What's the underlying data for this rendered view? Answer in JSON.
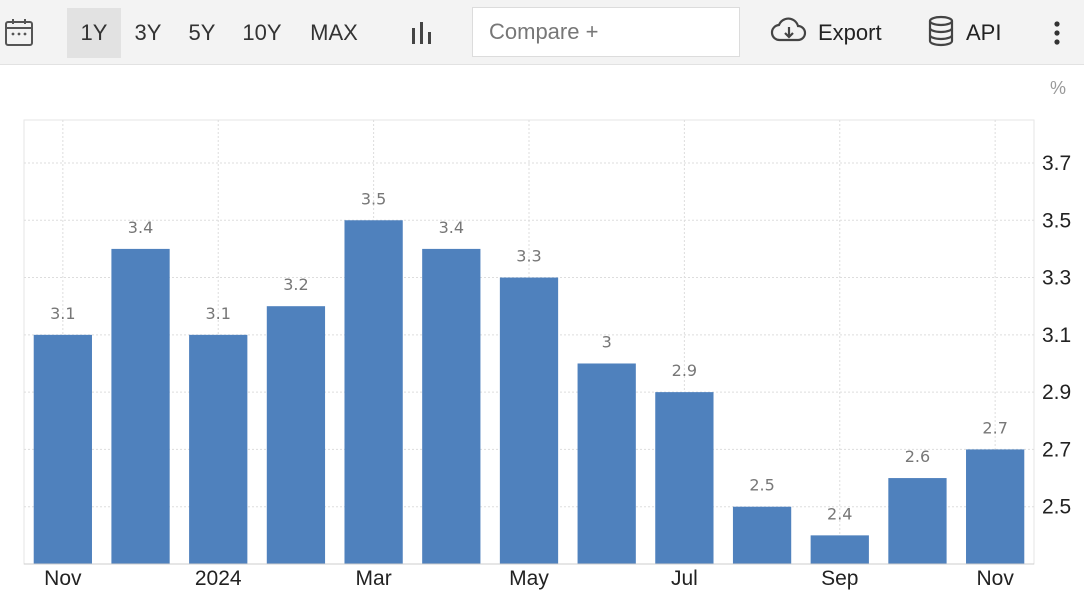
{
  "toolbar": {
    "calendar_icon": "calendar-icon",
    "ranges": [
      {
        "label": "1Y",
        "active": true
      },
      {
        "label": "3Y",
        "active": false
      },
      {
        "label": "5Y",
        "active": false
      },
      {
        "label": "10Y",
        "active": false
      },
      {
        "label": "MAX",
        "active": false
      }
    ],
    "chart_type_icon": "bar-chart-icon",
    "compare_placeholder": "Compare +",
    "export_label": "Export",
    "export_icon": "cloud-download-icon",
    "api_label": "API",
    "api_icon": "database-icon",
    "more_icon": "vertical-dots-icon"
  },
  "chart_data": {
    "type": "bar",
    "unit": "%",
    "categories": [
      "Nov 2023",
      "Dec 2023",
      "Jan 2024",
      "Feb 2024",
      "Mar 2024",
      "Apr 2024",
      "May 2024",
      "Jun 2024",
      "Jul 2024",
      "Aug 2024",
      "Sep 2024",
      "Oct 2024",
      "Nov 2024"
    ],
    "values": [
      3.1,
      3.4,
      3.1,
      3.2,
      3.5,
      3.4,
      3.3,
      3.0,
      2.9,
      2.5,
      2.4,
      2.6,
      2.7
    ],
    "data_labels": [
      "3.1",
      "3.4",
      "3.1",
      "3.2",
      "3.5",
      "3.4",
      "3.3",
      "3",
      "2.9",
      "2.5",
      "2.4",
      "2.6",
      "2.7"
    ],
    "x_tick_labels": [
      {
        "index": 0,
        "label": "Nov"
      },
      {
        "index": 2,
        "label": "2024"
      },
      {
        "index": 4,
        "label": "Mar"
      },
      {
        "index": 6,
        "label": "May"
      },
      {
        "index": 8,
        "label": "Jul"
      },
      {
        "index": 10,
        "label": "Sep"
      },
      {
        "index": 12,
        "label": "Nov"
      }
    ],
    "y_ticks": [
      2.5,
      2.7,
      2.9,
      3.1,
      3.3,
      3.5,
      3.7
    ],
    "y_tick_labels": [
      "2.5",
      "2.7",
      "2.9",
      "3.1",
      "3.3",
      "3.5",
      "3.7"
    ],
    "ylim": [
      2.3,
      3.85
    ],
    "y_axis_position": "right",
    "grid": true,
    "bar_color": "#4f81bd"
  }
}
